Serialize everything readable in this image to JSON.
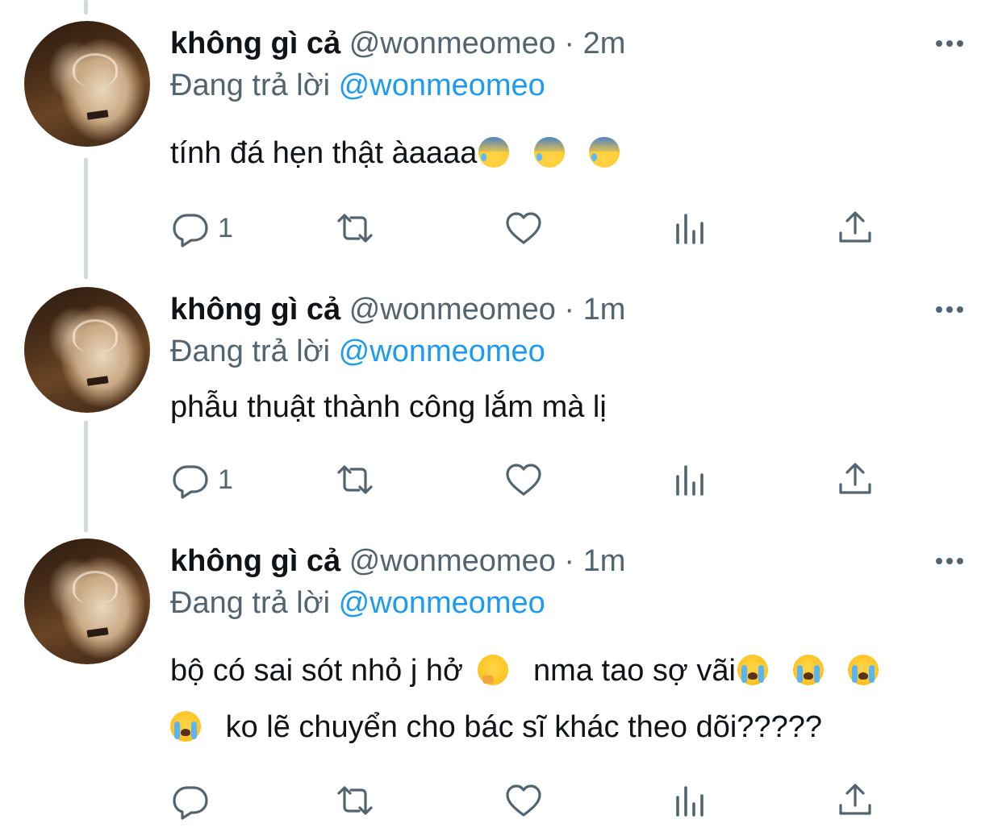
{
  "tweets": [
    {
      "name": "không gì cả",
      "handle": "@wonmeomeo",
      "separator": "·",
      "time": "2m",
      "reply_prefix": "Đang trả lời",
      "reply_to": "@wonmeomeo",
      "line1": "tính đá hẹn thật àaaaa",
      "reply_count": "1"
    },
    {
      "name": "không gì cả",
      "handle": "@wonmeomeo",
      "separator": "·",
      "time": "1m",
      "reply_prefix": "Đang trả lời",
      "reply_to": "@wonmeomeo",
      "line1": "phẫu thuật thành công lắm mà lị",
      "reply_count": "1"
    },
    {
      "name": "không gì cả",
      "handle": "@wonmeomeo",
      "separator": "·",
      "time": "1m",
      "reply_prefix": "Đang trả lời",
      "reply_to": "@wonmeomeo",
      "line1_a": "bộ có sai sót nhỏ j hở",
      "line1_b": "nma tao sợ vãi",
      "line2": "ko lẽ chuyển cho bác sĩ khác theo dõi?????",
      "reply_count": ""
    }
  ],
  "icons": {
    "reply": "reply-icon",
    "retweet": "retweet-icon",
    "like": "heart-icon",
    "views": "analytics-icon",
    "share": "share-icon",
    "more": "more-icon",
    "emoji_sweat": "anxious-face-with-sweat-emoji",
    "emoji_think": "thinking-face-emoji",
    "emoji_cry": "loudly-crying-face-emoji"
  },
  "colors": {
    "text": "#0f1419",
    "secondary": "#536471",
    "mention": "#1d9bf0",
    "thread_line": "#cfd9de"
  }
}
